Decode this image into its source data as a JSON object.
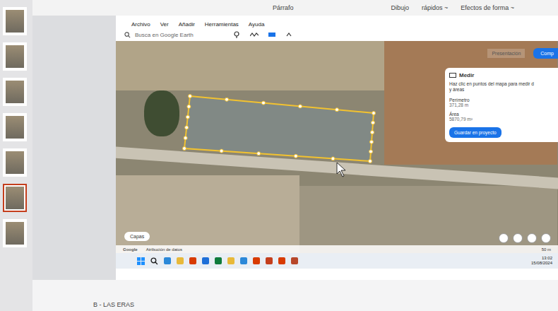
{
  "word": {
    "ribbon": [
      "Párrafo",
      "Dibujo",
      "rápidos ~",
      "Efectos de forma ~"
    ],
    "footer": "B - LAS ERAS"
  },
  "slides": [
    {
      "selected": false
    },
    {
      "selected": false
    },
    {
      "selected": false
    },
    {
      "selected": false
    },
    {
      "selected": false
    },
    {
      "selected": true
    },
    {
      "selected": false
    }
  ],
  "earth": {
    "menu": [
      "Archivo",
      "Ver",
      "Añadir",
      "Herramientas",
      "Ayuda"
    ],
    "search": {
      "placeholder": "Busca en Google Earth"
    },
    "buttons": [
      "Presentación",
      "Comp"
    ],
    "measure": {
      "title": "Medir",
      "hint": [
        "Haz clic en puntos del mapa para medir d",
        "y áreas"
      ],
      "perimeter_label": "Perímetro",
      "perimeter": "371,28 m",
      "area_label": "Área",
      "area": "5870,79 m²",
      "save": "Guardar en proyecto"
    },
    "layers": "Capas",
    "footer": {
      "logo": "Google",
      "attribution": "Atribución de datos",
      "scale": "50 m"
    }
  },
  "taskbar": {
    "time": "13:02",
    "date": "15/08/2024"
  }
}
